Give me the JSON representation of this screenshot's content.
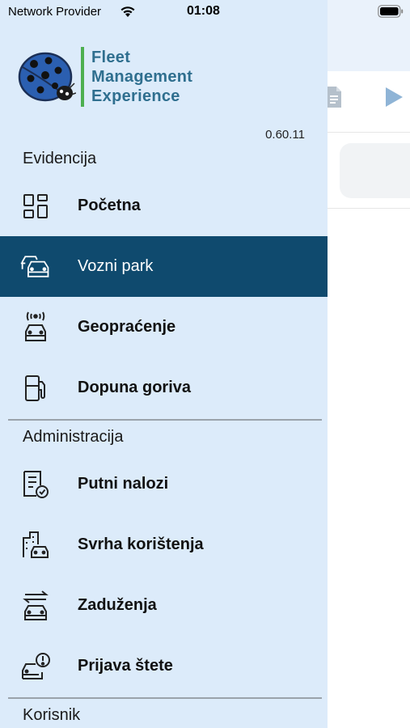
{
  "status": {
    "carrier": "Network Provider",
    "time": "01:08"
  },
  "logo": {
    "line1": "Fleet",
    "line2": "Management",
    "line3": "Experience"
  },
  "version": "0.60.11",
  "sections": {
    "evidencija": "Evidencija",
    "administracija": "Administracija",
    "korisnik": "Korisnik"
  },
  "menu": {
    "pocetna": "Početna",
    "vozni_park": "Vozni park",
    "geopracenje": "Geopraćenje",
    "dopuna_goriva": "Dopuna goriva",
    "putni_nalozi": "Putni nalozi",
    "svrha_koristenja": "Svrha korištenja",
    "zaduzenja": "Zaduženja",
    "prijava_stete": "Prijava štete"
  },
  "colors": {
    "drawer_bg": "#dcebfa",
    "active_bg": "#0f4a6e",
    "logo_text": "#2f6f8f",
    "logo_bar": "#4caf50"
  }
}
